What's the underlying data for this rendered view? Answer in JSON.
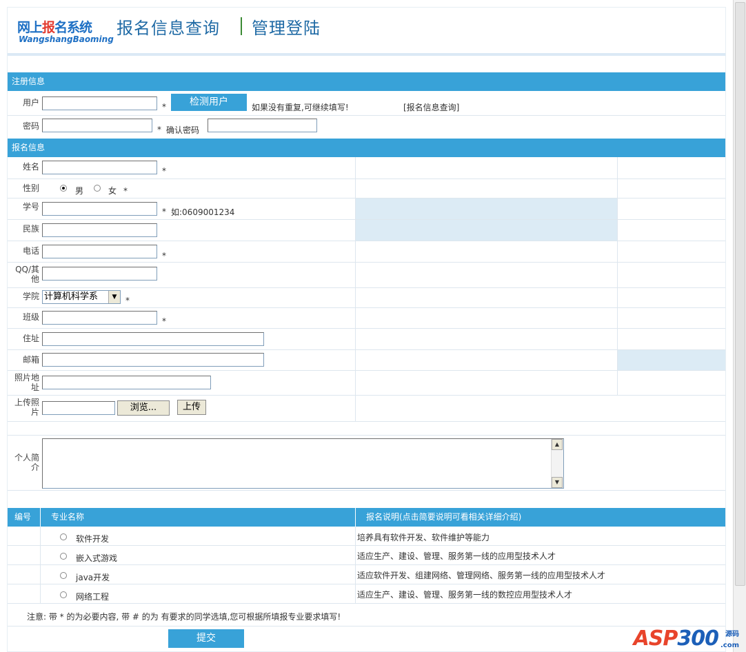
{
  "header": {
    "logo_cn_a": "网上",
    "logo_cn_red": "报",
    "logo_cn_b": "名系统",
    "logo_en": "WangshangBaoming",
    "nav_query": "报名信息查询",
    "nav_admin": "管理登陆"
  },
  "reg": {
    "section_title": "注册信息",
    "user_label": "用户",
    "user_value": "",
    "check_button": "检测用户",
    "check_hint": "如果没有重复,可继续填写!",
    "query_link": "[报名信息查询]",
    "password_label": "密码",
    "confirm_label": "确认密码",
    "required_mark": "*"
  },
  "info": {
    "section_title": "报名信息",
    "name_label": "姓名",
    "gender_label": "性别",
    "gender_male": "男",
    "gender_female": "女",
    "student_no_label": "学号",
    "student_no_hint": "如:0609001234",
    "ethnic_label": "民族",
    "phone_label": "电话",
    "qq_label_1": "QQ/其",
    "qq_label_2": "他",
    "college_label": "学院",
    "college_selected": "计算机科学系",
    "class_label": "班级",
    "address_label": "住址",
    "email_label": "邮箱",
    "photo_addr_label_1": "照片地",
    "photo_addr_label_2": "址",
    "upload_label_1": "上传照",
    "upload_label_2": "片",
    "browse_button": "浏览...",
    "upload_button": "上传",
    "intro_label_1": "个人简",
    "intro_label_2": "介"
  },
  "majors": {
    "col_no": "编号",
    "col_name": "专业名称",
    "col_desc": "报名说明(点击简要说明可看相关详细介绍)",
    "rows": [
      {
        "name": "软件开发",
        "desc": "培养具有软件开发、软件维护等能力"
      },
      {
        "name": "嵌入式游戏",
        "desc": "适应生产、建设、管理、服务第一线的应用型技术人才"
      },
      {
        "name": "java开发",
        "desc": "适应软件开发、组建网络、管理网络、服务第一线的应用型技术人才"
      },
      {
        "name": "网络工程",
        "desc": "适应生产、建设、管理、服务第一线的数控应用型技术人才"
      }
    ]
  },
  "footer": {
    "note": "注意: 带 * 的为必要内容, 带 # 的为 有要求的同学选填,您可根据所填报专业要求填写!",
    "submit": "提交"
  },
  "watermark": {
    "text_a": "ASP",
    "text_b": "300",
    "sub_a": "源码",
    "sub_b": ".com"
  },
  "colors": {
    "section": "#38a2d8",
    "light_blue": "#dcebf5",
    "nav": "#1f6aa5"
  }
}
